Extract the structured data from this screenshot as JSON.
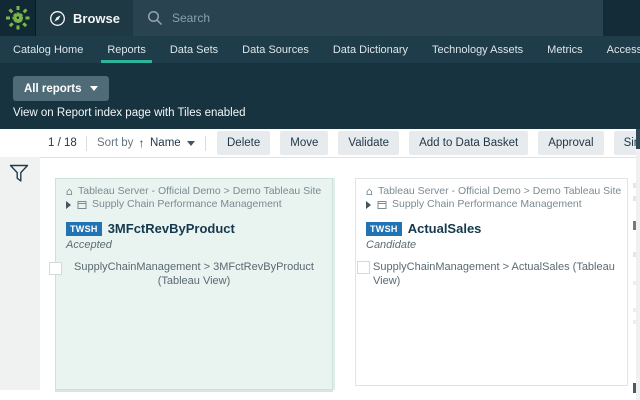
{
  "topbar": {
    "browse_label": "Browse",
    "search_placeholder": "Search"
  },
  "nav": {
    "items": [
      "Catalog Home",
      "Reports",
      "Data Sets",
      "Data Sources",
      "Data Dictionary",
      "Technology Assets",
      "Metrics",
      "Access Requests"
    ],
    "active_item": "Reports"
  },
  "hero": {
    "filter_button_label": "All reports",
    "caption": "View on Report index page with Tiles enabled"
  },
  "toolbar": {
    "page_indicator": "1 / 18",
    "sort_by_label": "Sort by",
    "sort_field": "Name",
    "buttons": [
      "Delete",
      "Move",
      "Validate",
      "Add to Data Basket",
      "Approval",
      "Simple Approval"
    ]
  },
  "cards": [
    {
      "source": "Tableau Server - Official Demo > Demo Tableau Site",
      "folder": "Supply Chain Performance Management",
      "badge": "TWSH",
      "title": "3MFctRevByProduct",
      "status": "Accepted",
      "path": "SupplyChainManagement > 3MFctRevByProduct (Tableau View)",
      "selected": true
    },
    {
      "source": "Tableau Server - Official Demo > Demo Tableau Site",
      "folder": "Supply Chain Performance Management",
      "badge": "TWSH",
      "title": "ActualSales",
      "status": "Candidate",
      "path": "SupplyChainManagement > ActualSales (Tableau View)",
      "selected": false
    }
  ],
  "colors": {
    "accent_teal": "#2db49a",
    "badge_blue": "#2273b4",
    "logo_green": "#7ab648",
    "selected_card_bg": "#e9f3ef",
    "topbar_bg": "#132c37"
  }
}
